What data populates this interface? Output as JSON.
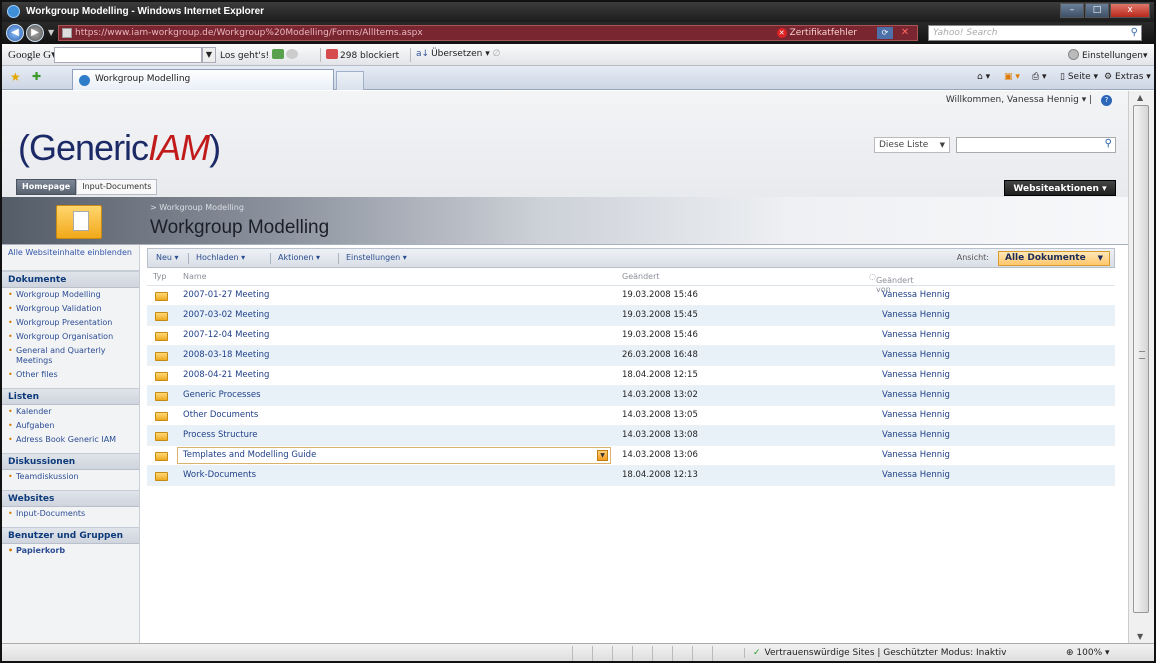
{
  "window": {
    "title": "Workgroup Modelling - Windows Internet Explorer",
    "buttons": {
      "minimize": "–",
      "maximize": "□",
      "close": "x"
    }
  },
  "addressbar": {
    "url": "https://www.iam-workgroup.de/Workgroup%20Modelling/Forms/AllItems.aspx",
    "cert_error": "Zertifikatfehler",
    "search_placeholder": "Yahoo! Search",
    "search_icon": "magnifier-icon"
  },
  "google_toolbar": {
    "logo": "Google",
    "search_go": "Los geht's!",
    "blocked": "298 blockiert",
    "translate": "Übersetzen",
    "settings": "Einstellungen"
  },
  "tabbar": {
    "tab_label": "Workgroup Modelling",
    "cmd_page": "Seite",
    "cmd_extras": "Extras"
  },
  "site": {
    "welcome": "Willkommen, Vanessa Hennig",
    "logo_generic": "Generic",
    "logo_iam": "IAM",
    "search_scope": "Diese Liste",
    "top_tabs": [
      "Homepage",
      "Input-Documents"
    ],
    "site_actions": "Websiteaktionen",
    "breadcrumb": "> Workgroup Modelling",
    "page_title": "Workgroup Modelling"
  },
  "sidebar": {
    "view_all": "Alle Websiteinhalte einblenden",
    "sections": [
      {
        "heading": "Dokumente",
        "items": [
          "Workgroup Modelling",
          "Workgroup Validation",
          "Workgroup Presentation",
          "Workgroup Organisation",
          "General and Quarterly Meetings",
          "Other files"
        ]
      },
      {
        "heading": "Listen",
        "items": [
          "Kalender",
          "Aufgaben",
          "Adress Book Generic IAM"
        ]
      },
      {
        "heading": "Diskussionen",
        "items": [
          "Teamdiskussion"
        ]
      },
      {
        "heading": "Websites",
        "items": [
          "Input-Documents"
        ]
      },
      {
        "heading": "Benutzer und Gruppen",
        "items": []
      }
    ],
    "recycle_bin": "Papierkorb"
  },
  "toolbar": {
    "new": "Neu",
    "upload": "Hochladen",
    "actions": "Aktionen",
    "settings": "Einstellungen",
    "view_label": "Ansicht:",
    "view_value": "Alle Dokumente"
  },
  "grid": {
    "columns": {
      "type": "Typ",
      "name": "Name",
      "modified": "Geändert",
      "modified_by": "Geändert von"
    },
    "rows": [
      {
        "name": "2007-01-27 Meeting",
        "modified": "19.03.2008 15:46",
        "by": "Vanessa Hennig"
      },
      {
        "name": "2007-03-02 Meeting",
        "modified": "19.03.2008 15:45",
        "by": "Vanessa Hennig"
      },
      {
        "name": "2007-12-04 Meeting",
        "modified": "19.03.2008 15:46",
        "by": "Vanessa Hennig"
      },
      {
        "name": "2008-03-18 Meeting",
        "modified": "26.03.2008 16:48",
        "by": "Vanessa Hennig"
      },
      {
        "name": "2008-04-21 Meeting",
        "modified": "18.04.2008 12:15",
        "by": "Vanessa Hennig"
      },
      {
        "name": "Generic Processes",
        "modified": "14.03.2008 13:02",
        "by": "Vanessa Hennig"
      },
      {
        "name": "Other Documents",
        "modified": "14.03.2008 13:05",
        "by": "Vanessa Hennig"
      },
      {
        "name": "Process Structure",
        "modified": "14.03.2008 13:08",
        "by": "Vanessa Hennig"
      },
      {
        "name": "Templates and Modelling Guide",
        "modified": "14.03.2008 13:06",
        "by": "Vanessa Hennig"
      },
      {
        "name": "Work-Documents",
        "modified": "18.04.2008 12:13",
        "by": "Vanessa Hennig"
      }
    ]
  },
  "statusbar": {
    "zone": "Vertrauenswürdige Sites | Geschützter Modus: Inaktiv",
    "zoom": "100%"
  }
}
